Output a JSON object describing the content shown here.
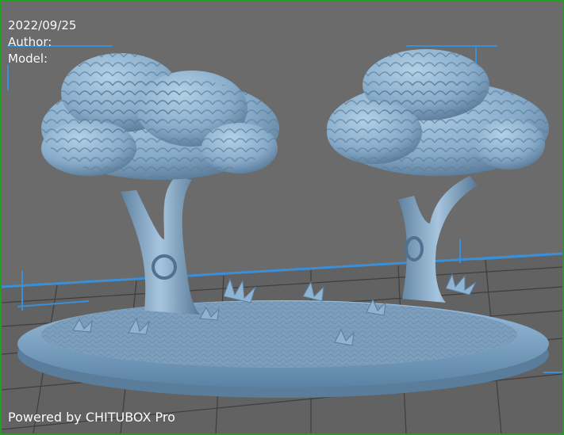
{
  "meta": {
    "date": "2022/09/25",
    "author_label": "Author:",
    "model_label": "Model:",
    "powered_by": "Powered by CHITUBOX Pro"
  },
  "colors": {
    "background": "#6b6b6b",
    "frame_border": "#1fa11f",
    "platform_grid": "#3a3a3a",
    "platform_edge": "#3b8fd6",
    "model_base": "#8fb6d6",
    "model_shadow": "#4f7290",
    "text": "#ffffff"
  },
  "scene": {
    "object": "two-tree-diorama-model",
    "icons": [
      "printer-build-plate",
      "bounding-box-marker"
    ]
  }
}
